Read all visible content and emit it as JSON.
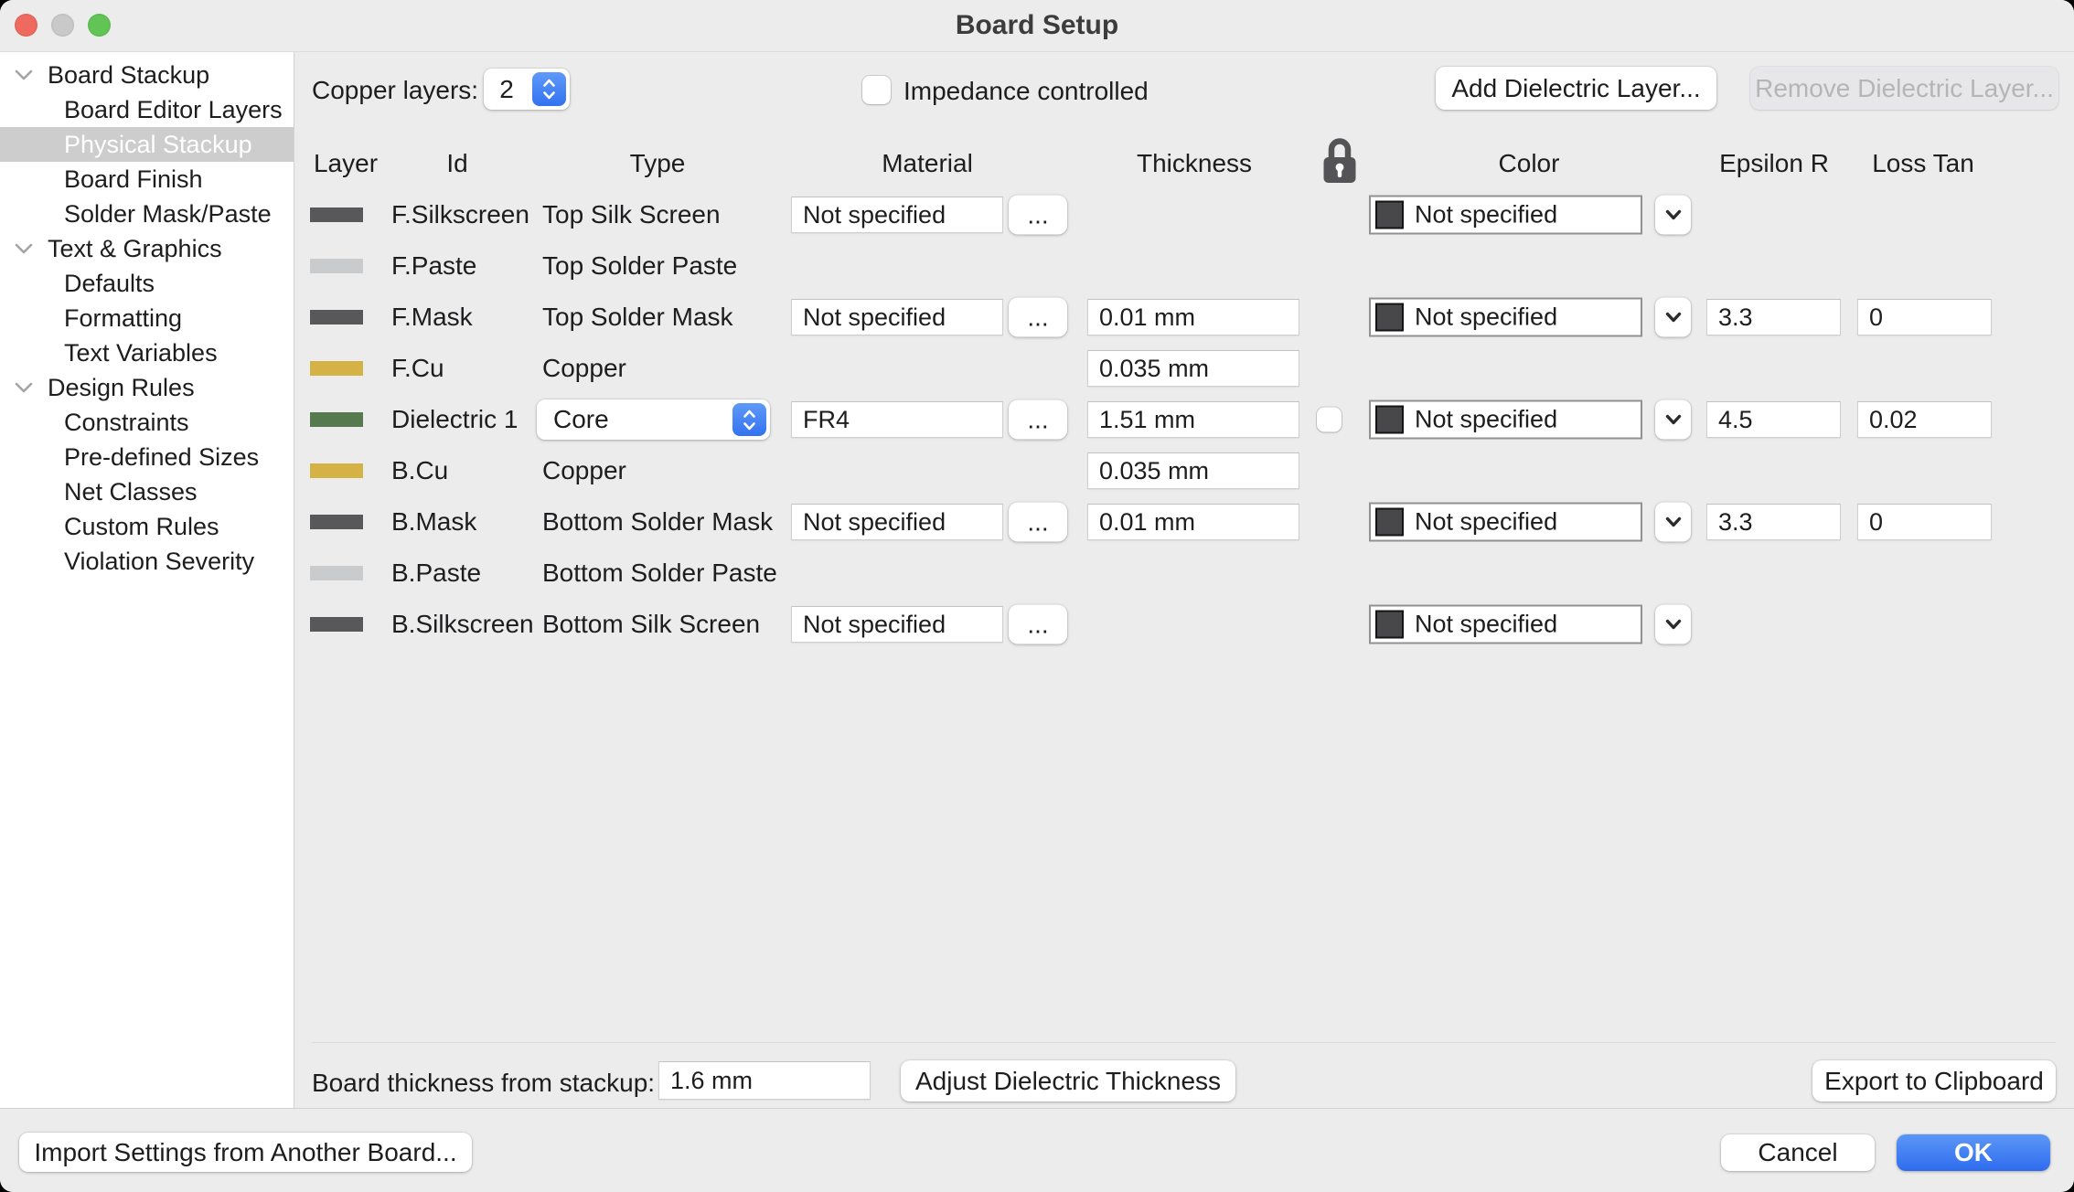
{
  "window": {
    "title": "Board Setup"
  },
  "colors": {
    "accent_blue": "#3372f1",
    "traffic_red": "#ee6a5f",
    "traffic_gray": "#c9c9c9",
    "traffic_green": "#61c454",
    "swatch_dark": "#58585a",
    "swatch_light": "#c9cbcc",
    "swatch_copper": "#d5b245",
    "swatch_dielectric": "#557a4d",
    "color_combo_swatch": "#48484a"
  },
  "sidebar": {
    "items": [
      {
        "label": "Board Stackup",
        "level": 0,
        "chevron": true,
        "selected": false
      },
      {
        "label": "Board Editor Layers",
        "level": 1,
        "chevron": false,
        "selected": false
      },
      {
        "label": "Physical Stackup",
        "level": 1,
        "chevron": false,
        "selected": true
      },
      {
        "label": "Board Finish",
        "level": 1,
        "chevron": false,
        "selected": false
      },
      {
        "label": "Solder Mask/Paste",
        "level": 1,
        "chevron": false,
        "selected": false
      },
      {
        "label": "Text & Graphics",
        "level": 0,
        "chevron": true,
        "selected": false
      },
      {
        "label": "Defaults",
        "level": 1,
        "chevron": false,
        "selected": false
      },
      {
        "label": "Formatting",
        "level": 1,
        "chevron": false,
        "selected": false
      },
      {
        "label": "Text Variables",
        "level": 1,
        "chevron": false,
        "selected": false
      },
      {
        "label": "Design Rules",
        "level": 0,
        "chevron": true,
        "selected": false
      },
      {
        "label": "Constraints",
        "level": 1,
        "chevron": false,
        "selected": false
      },
      {
        "label": "Pre-defined Sizes",
        "level": 1,
        "chevron": false,
        "selected": false
      },
      {
        "label": "Net Classes",
        "level": 1,
        "chevron": false,
        "selected": false
      },
      {
        "label": "Custom Rules",
        "level": 1,
        "chevron": false,
        "selected": false
      },
      {
        "label": "Violation Severity",
        "level": 1,
        "chevron": false,
        "selected": false
      }
    ]
  },
  "toolbar": {
    "copper_layers_label": "Copper layers:",
    "copper_layers_value": "2",
    "impedance_label": "Impedance controlled",
    "impedance_checked": false,
    "add_button": "Add Dielectric Layer...",
    "remove_button": "Remove Dielectric Layer...",
    "remove_disabled": true
  },
  "table": {
    "headers": {
      "layer": "Layer",
      "id": "Id",
      "type": "Type",
      "material": "Material",
      "thickness": "Thickness",
      "color": "Color",
      "epsilon": "Epsilon R",
      "loss": "Loss Tan"
    },
    "browse_label": "...",
    "rows": [
      {
        "id": "F.Silkscreen",
        "swatch": "#58585a",
        "type": "Top Silk Screen",
        "type_is_dropdown": false,
        "material": "Not specified",
        "thickness": null,
        "lock_checkbox": false,
        "color": "Not specified",
        "epsilon": null,
        "loss": null
      },
      {
        "id": "F.Paste",
        "swatch": "#c9cbcc",
        "type": "Top Solder Paste",
        "type_is_dropdown": false,
        "material": null,
        "thickness": null,
        "lock_checkbox": false,
        "color": null,
        "epsilon": null,
        "loss": null
      },
      {
        "id": "F.Mask",
        "swatch": "#58585a",
        "type": "Top Solder Mask",
        "type_is_dropdown": false,
        "material": "Not specified",
        "thickness": "0.01 mm",
        "lock_checkbox": false,
        "color": "Not specified",
        "epsilon": "3.3",
        "loss": "0"
      },
      {
        "id": "F.Cu",
        "swatch": "#d5b245",
        "type": "Copper",
        "type_is_dropdown": false,
        "material": null,
        "thickness": "0.035 mm",
        "lock_checkbox": false,
        "color": null,
        "epsilon": null,
        "loss": null
      },
      {
        "id": "Dielectric 1",
        "swatch": "#557a4d",
        "type": "Core",
        "type_is_dropdown": true,
        "material": "FR4",
        "thickness": "1.51 mm",
        "lock_checkbox": true,
        "color": "Not specified",
        "epsilon": "4.5",
        "loss": "0.02"
      },
      {
        "id": "B.Cu",
        "swatch": "#d5b245",
        "type": "Copper",
        "type_is_dropdown": false,
        "material": null,
        "thickness": "0.035 mm",
        "lock_checkbox": false,
        "color": null,
        "epsilon": null,
        "loss": null
      },
      {
        "id": "B.Mask",
        "swatch": "#58585a",
        "type": "Bottom Solder Mask",
        "type_is_dropdown": false,
        "material": "Not specified",
        "thickness": "0.01 mm",
        "lock_checkbox": false,
        "color": "Not specified",
        "epsilon": "3.3",
        "loss": "0"
      },
      {
        "id": "B.Paste",
        "swatch": "#c9cbcc",
        "type": "Bottom Solder Paste",
        "type_is_dropdown": false,
        "material": null,
        "thickness": null,
        "lock_checkbox": false,
        "color": null,
        "epsilon": null,
        "loss": null
      },
      {
        "id": "B.Silkscreen",
        "swatch": "#58585a",
        "type": "Bottom Silk Screen",
        "type_is_dropdown": false,
        "material": "Not specified",
        "thickness": null,
        "lock_checkbox": false,
        "color": "Not specified",
        "epsilon": null,
        "loss": null
      }
    ]
  },
  "footer": {
    "board_thickness_label": "Board thickness from stackup:",
    "board_thickness_value": "1.6 mm",
    "adjust_button": "Adjust Dielectric Thickness",
    "export_button": "Export to Clipboard"
  },
  "actions": {
    "import_button": "Import Settings from Another Board...",
    "cancel_button": "Cancel",
    "ok_button": "OK"
  }
}
